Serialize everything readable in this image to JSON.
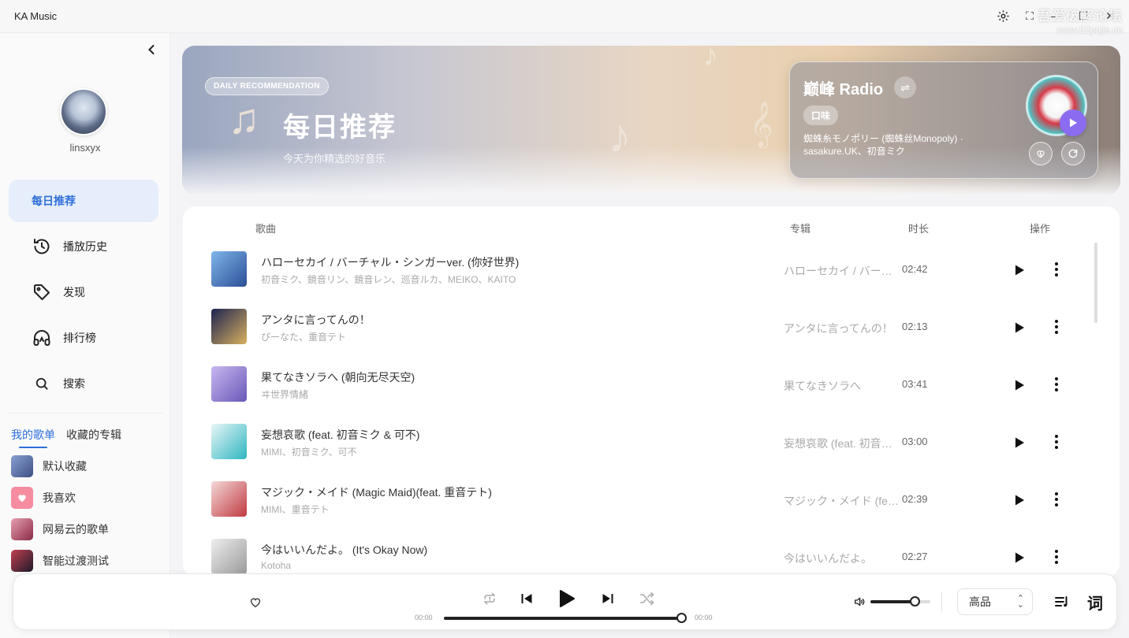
{
  "app": {
    "title": "KA Music",
    "watermark_line1": "吾爱破解论坛",
    "watermark_line2": "www.52pojie.cn"
  },
  "user": {
    "name": "linsxyx"
  },
  "nav": [
    {
      "label": "每日推荐",
      "icon": "calendar-icon",
      "active": true
    },
    {
      "label": "播放历史",
      "icon": "history-icon"
    },
    {
      "label": "发现",
      "icon": "tag-icon"
    },
    {
      "label": "排行榜",
      "icon": "headphones-icon"
    },
    {
      "label": "搜索",
      "icon": "search-icon"
    }
  ],
  "playlist_tabs": {
    "mine": "我的歌单",
    "collected": "收藏的专辑"
  },
  "playlists": [
    {
      "name": "默认收藏",
      "color": "#6b7fb3"
    },
    {
      "name": "我喜欢",
      "color": "#f58ca0"
    },
    {
      "name": "网易云的歌单",
      "color": "#b0405a"
    },
    {
      "name": "智能过渡测试",
      "color": "#3a2a40"
    }
  ],
  "hero": {
    "badge": "DAILY RECOMMENDATION",
    "title": "每日推荐",
    "subtitle": "今天为你精选的好音乐"
  },
  "radio": {
    "title": "巅峰 Radio",
    "tag": "口味",
    "song": "蜘蛛糸モノポリー (蜘蛛丝Monopoly) · sasakure.UK、初音ミク"
  },
  "list_headers": {
    "song": "歌曲",
    "album": "专辑",
    "duration": "时长",
    "actions": "操作"
  },
  "songs": [
    {
      "title": "ハローセカイ / バーチャル・シンガーver. (你好世界)",
      "artist": "初音ミク、鏡音リン、鏡音レン、巡音ルカ、MEIKO、KAITO",
      "album": "ハローセカイ / バーチャル・シンガーver.",
      "duration": "02:42",
      "cover": "#3a5fa8"
    },
    {
      "title": "アンタに言ってんの！",
      "artist": "ぴーなた、重音テト",
      "album": "アンタに言ってんの！",
      "duration": "02:13",
      "cover": "#23305f"
    },
    {
      "title": "果てなきソラへ (朝向无尽天空)",
      "artist": "ヰ世界情緒",
      "album": "果てなきソラへ",
      "duration": "03:41",
      "cover": "#9a8ad8"
    },
    {
      "title": "妄想哀歌 (feat. 初音ミク & 可不)",
      "artist": "MIMI、初音ミク、可不",
      "album": "妄想哀歌 (feat. 初音ミク & 可不)",
      "duration": "03:00",
      "cover": "#3fc2c8"
    },
    {
      "title": "マジック・メイド (Magic Maid)(feat. 重音テト)",
      "artist": "MIMI、重音テト",
      "album": "マジック・メイド (feat. 重音テト)",
      "duration": "02:39",
      "cover": "#c84a50"
    },
    {
      "title": "今はいいんだよ。 (It's Okay Now)",
      "artist": "Kotoha",
      "album": "今はいいんだよ。",
      "duration": "02:27",
      "cover": "#b8b8b8"
    }
  ],
  "player": {
    "current_time": "00:00",
    "total_time": "00:00",
    "progress": 1.0,
    "volume": 0.75,
    "quality": "高品"
  },
  "colors": {
    "accent": "#2f6fd8",
    "radio_play": "#8b6cf0"
  }
}
